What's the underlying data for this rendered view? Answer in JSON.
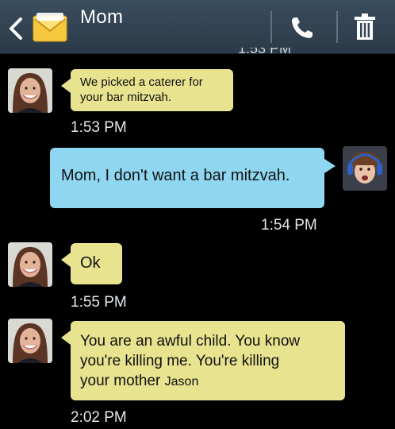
{
  "header": {
    "title": "Mom",
    "back_icon": "chevron-left-icon",
    "app_icon": "envelope-icon",
    "call_icon": "phone-icon",
    "delete_icon": "trash-icon"
  },
  "cut_timestamp": "1:53 PM",
  "messages": [
    {
      "direction": "incoming",
      "text_line1": "We picked a caterer for",
      "text_line2": "your bar mitzvah.",
      "time": "1:53 PM"
    },
    {
      "direction": "outgoing",
      "text": "Mom, I don't want a bar mitzvah.",
      "time": "1:54 PM"
    },
    {
      "direction": "incoming",
      "text": "Ok",
      "time": "1:55 PM"
    },
    {
      "direction": "incoming",
      "text_line1": "You are an awful child. You know",
      "text_line2": "you're killing me. You're killing",
      "text_line3": "your mother",
      "signature": "Jason",
      "time": "2:02 PM"
    }
  ],
  "colors": {
    "incoming_bubble": "#e7e38f",
    "outgoing_bubble": "#8fd6f0",
    "header": "#34475a"
  }
}
